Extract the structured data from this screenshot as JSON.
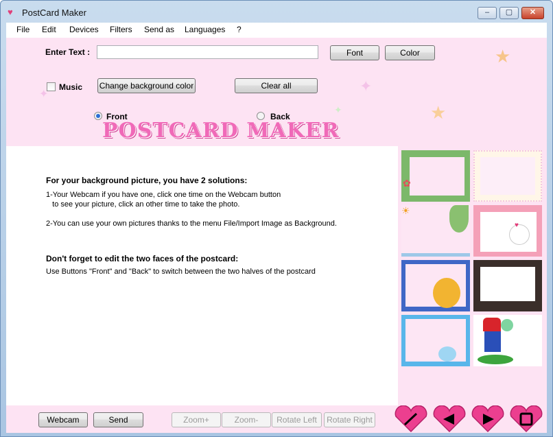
{
  "window": {
    "title": "PostCard Maker",
    "controls": {
      "minimize": "–",
      "maximize": "▢",
      "close": "✕"
    }
  },
  "menu": [
    "File",
    "Edit",
    "Devices",
    "Filters",
    "Send as",
    "Languages",
    "?"
  ],
  "top": {
    "enter_text_label": "Enter Text :",
    "text_value": "",
    "font_button": "Font",
    "color_button": "Color",
    "music_label": "Music",
    "music_checked": false,
    "change_bg_button": "Change background color",
    "clear_all_button": "Clear all",
    "front_label": "Front",
    "back_label": "Back",
    "selected_side": "Front",
    "logo_text": "POSTCARD MAKER"
  },
  "instructions": {
    "heading1": "For your background picture, you have 2 solutions:",
    "line1": "1-Your Webcam if you have one, click one time on the Webcam button",
    "line2": "   to see your picture, click an other time to take the photo.",
    "line3": "2-You can use your own pictures thanks to the menu File/Import Image as Background.",
    "heading2": "Don't forget to edit the two faces of the postcard:",
    "line4": "Use Buttons \"Front\" and \"Back\" to switch between the two halves of the postcard"
  },
  "bottom": {
    "webcam_button": "Webcam",
    "send_button": "Send",
    "zoom_in_button": "Zoom+",
    "zoom_out_button": "Zoom-",
    "rotate_left_button": "Rotate Left",
    "rotate_right_button": "Rotate Right"
  },
  "tools": [
    "pencil-icon",
    "arrow-left-icon",
    "arrow-right-icon",
    "square-icon"
  ],
  "colors": {
    "panel_pink": "#fde3f3",
    "logo_pink": "#f06ab8",
    "heart_pink": "#ec3f8f"
  }
}
